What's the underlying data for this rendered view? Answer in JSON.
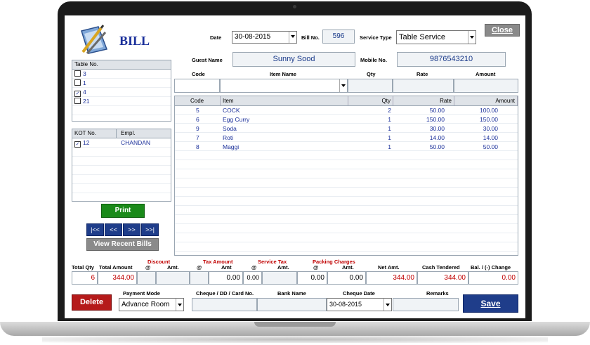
{
  "header": {
    "title": "BILL",
    "date_label": "Date",
    "date_value": "30-08-2015",
    "bill_no_label": "Bill No.",
    "bill_no_value": "596",
    "service_type_label": "Service Type",
    "service_type_value": "Table Service",
    "close_label": "Close",
    "guest_name_label": "Guest Name",
    "guest_name_value": "Sunny Sood",
    "mobile_label": "Mobile No.",
    "mobile_value": "9876543210"
  },
  "entry": {
    "code_label": "Code",
    "item_name_label": "Item Name",
    "qty_label": "Qty",
    "rate_label": "Rate",
    "amount_label": "Amount"
  },
  "items_table": {
    "columns": [
      "Code",
      "Item",
      "Qty",
      "Rate",
      "Amount"
    ],
    "rows": [
      [
        "5",
        "COCK",
        "2",
        "50.00",
        "100.00"
      ],
      [
        "6",
        "Egg Curry",
        "1",
        "150.00",
        "150.00"
      ],
      [
        "9",
        "Soda",
        "1",
        "30.00",
        "30.00"
      ],
      [
        "7",
        "Roti",
        "1",
        "14.00",
        "14.00"
      ],
      [
        "8",
        "Maggi",
        "1",
        "50.00",
        "50.00"
      ]
    ]
  },
  "tables_panel": {
    "header": "Table No.",
    "items": [
      {
        "label": "3",
        "checked": false
      },
      {
        "label": "1",
        "checked": false
      },
      {
        "label": "4",
        "checked": true
      },
      {
        "label": "21",
        "checked": false
      }
    ]
  },
  "kot_panel": {
    "col_kot": "KOT No.",
    "col_empl": "Empl.",
    "rows": [
      {
        "kot": "12",
        "empl": "CHANDAN",
        "checked": true
      }
    ]
  },
  "buttons": {
    "print": "Print",
    "first": "|<<",
    "prev": "<<",
    "next": ">>",
    "last": ">>|",
    "view_recent": "View Recent Bills",
    "delete": "Delete",
    "save": "Save"
  },
  "totals": {
    "total_qty_label": "Total Qty",
    "total_amount_label": "Total Amount",
    "discount_label": "Discount",
    "tax_amount_label": "Tax Amount",
    "service_tax_label": "Service Tax",
    "packing_charges_label": "Packing Charges",
    "at_label": "@",
    "amt_label": "Amt.",
    "amt_label_short": "Amt",
    "net_amt_label": "Net Amt.",
    "cash_tendered_label": "Cash Tendered",
    "balance_label": "Bal. / (-) Change",
    "total_qty": "6",
    "total_amount": "344.00",
    "tax_amount": "0.00",
    "service_tax_rate": "0.00",
    "service_tax_amt": "0.00",
    "packing_rate": "0.00",
    "packing_amt": "0.00",
    "net_amt": "344.00",
    "cash_tendered": "344.00",
    "balance": "0.00"
  },
  "payment": {
    "mode_label": "Payment Mode",
    "mode_value": "Advance Room",
    "cheque_label": "Cheque / DD / Card No.",
    "bank_label": "Bank Name",
    "cheque_date_label": "Cheque Date",
    "cheque_date_value": "30-08-2015",
    "remarks_label": "Remarks"
  },
  "colors": {
    "accent_blue": "#1f3d8a",
    "print_green": "#1a8a1a",
    "delete_red": "#b51a1a",
    "label_red": "#c00000"
  }
}
